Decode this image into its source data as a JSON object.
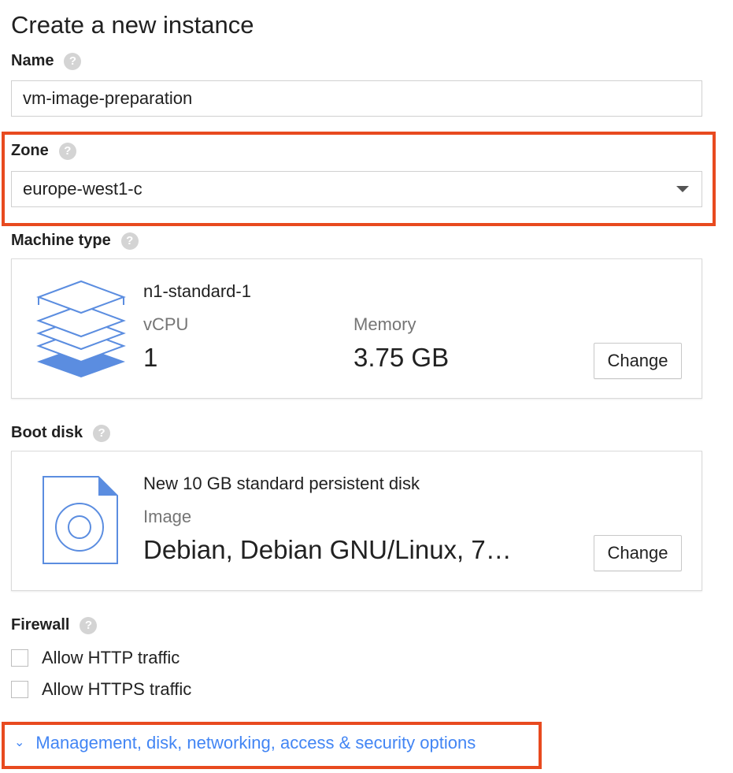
{
  "page": {
    "title": "Create a new instance"
  },
  "name_section": {
    "label": "Name",
    "value": "vm-image-preparation"
  },
  "zone_section": {
    "label": "Zone",
    "selected": "europe-west1-c"
  },
  "machine_type": {
    "label": "Machine type",
    "name": "n1-standard-1",
    "vcpu_label": "vCPU",
    "vcpu_value": "1",
    "memory_label": "Memory",
    "memory_value": "3.75 GB",
    "change_label": "Change"
  },
  "boot_disk": {
    "label": "Boot disk",
    "description": "New 10 GB standard persistent disk",
    "image_label": "Image",
    "image_value": "Debian, Debian GNU/Linux, 7…",
    "change_label": "Change"
  },
  "firewall": {
    "label": "Firewall",
    "options": [
      {
        "label": "Allow HTTP traffic",
        "checked": false
      },
      {
        "label": "Allow HTTPS traffic",
        "checked": false
      }
    ]
  },
  "more_options": {
    "label": "Management, disk, networking, access & security options"
  },
  "colors": {
    "highlight": "#e84a1f",
    "link": "#4285f4",
    "icon_blue": "#5b8de0"
  },
  "icons": {
    "help": "question-circle-icon",
    "machine": "stacked-layers-icon",
    "disk": "disk-file-icon",
    "expand": "double-chevron-down-icon"
  }
}
